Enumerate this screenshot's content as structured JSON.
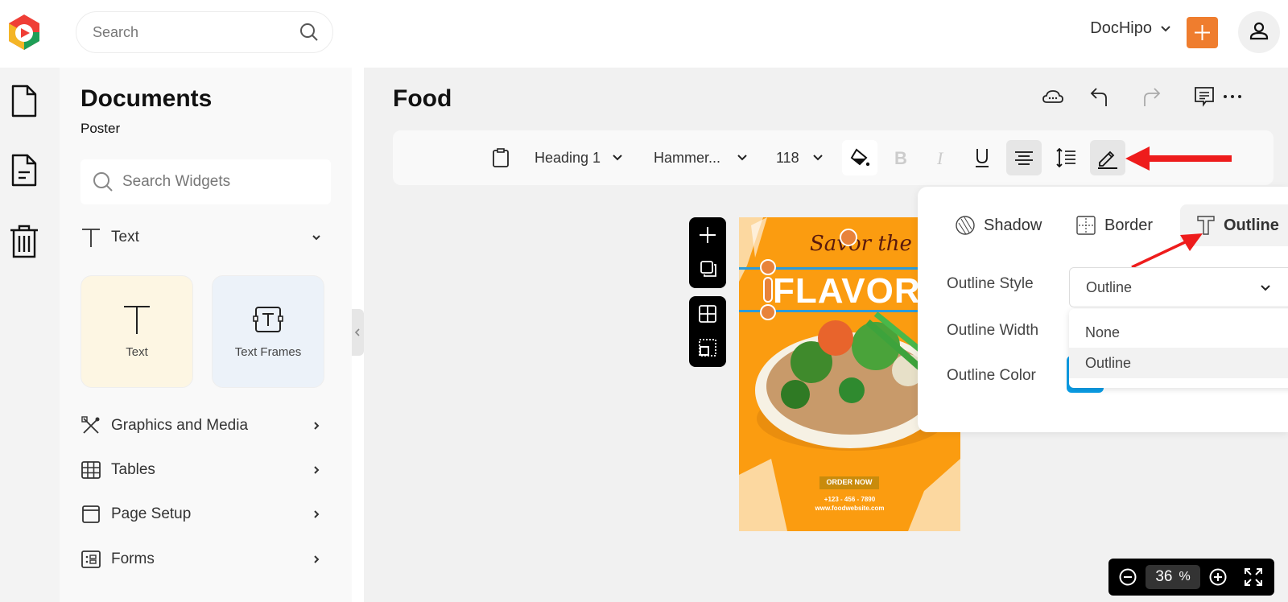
{
  "topbar": {
    "search_placeholder": "Search",
    "workspace": "DocHipo",
    "brand_accent": "#ef7d2e"
  },
  "rail": {
    "items": [
      {
        "icon": "document-icon"
      },
      {
        "icon": "document-text-icon"
      },
      {
        "icon": "trash-icon"
      }
    ]
  },
  "panel": {
    "title": "Documents",
    "subtitle": "Poster",
    "search_placeholder": "Search Widgets",
    "text_section": "Text",
    "cards": [
      {
        "label": "Text",
        "color": "#fdf6e3"
      },
      {
        "label": "Text Frames",
        "color": "#ecf2f9"
      }
    ],
    "sections": [
      {
        "label": "Graphics and Media",
        "icon": "graphics-icon"
      },
      {
        "label": "Tables",
        "icon": "table-icon"
      },
      {
        "label": "Page Setup",
        "icon": "page-setup-icon"
      },
      {
        "label": "Forms",
        "icon": "forms-icon"
      }
    ]
  },
  "main": {
    "doc_title": "Food",
    "toolbar": {
      "style": "Heading 1",
      "font": "Hammer...",
      "size": "118"
    }
  },
  "poster": {
    "script_line": "Savor the",
    "headline": "FLAVOR",
    "cta": "ORDER NOW",
    "phone": "+123 - 456 - 7890",
    "website": "www.foodwebsite.com",
    "bg_color": "#fb9c10"
  },
  "effects_panel": {
    "tabs": [
      {
        "label": "Shadow",
        "active": false
      },
      {
        "label": "Border",
        "active": false
      },
      {
        "label": "Outline",
        "active": true
      }
    ],
    "outline_style_label": "Outline Style",
    "outline_style_value": "Outline",
    "outline_width_label": "Outline Width",
    "outline_color_label": "Outline Color",
    "outline_color": "#0a9de6",
    "options": [
      "None",
      "Outline"
    ],
    "highlighted_option": "Outline"
  },
  "zoom": {
    "value": "36",
    "unit": "%"
  }
}
